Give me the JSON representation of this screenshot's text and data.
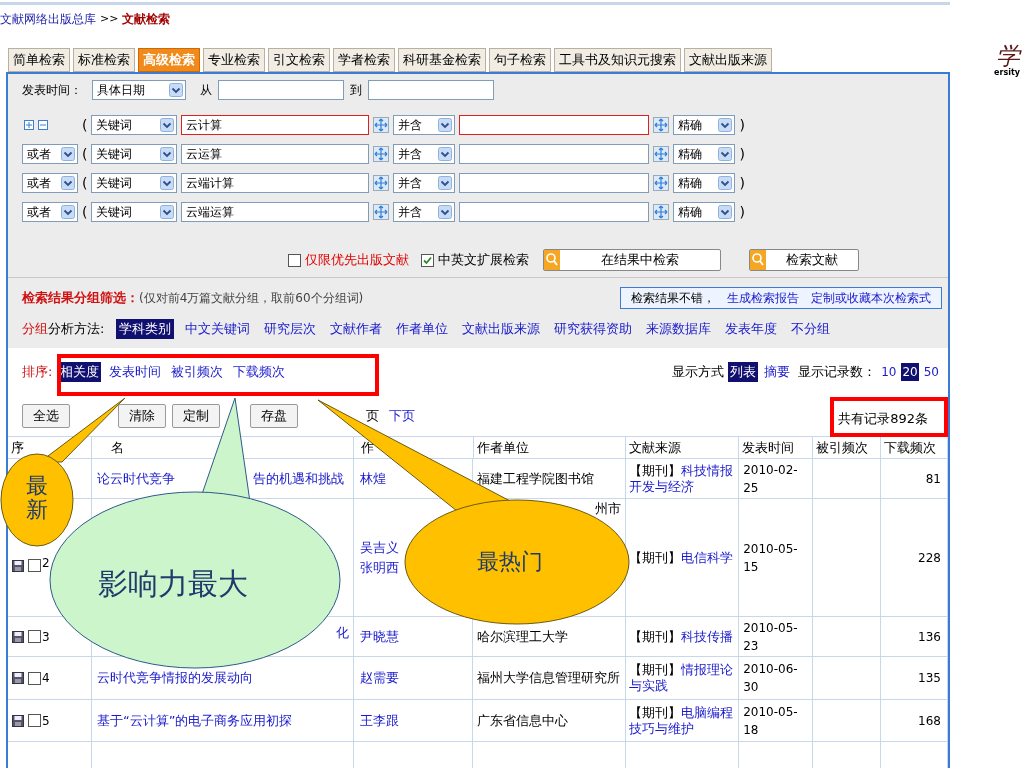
{
  "breadcrumb": {
    "path": "文献网络出版总库",
    "separator": ">>",
    "current": "文献检索"
  },
  "tabs": [
    {
      "label": "简单检索",
      "selected": false
    },
    {
      "label": "标准检索",
      "selected": false
    },
    {
      "label": "高级检索",
      "selected": true
    },
    {
      "label": "专业检索",
      "selected": false
    },
    {
      "label": "引文检索",
      "selected": false
    },
    {
      "label": "学者检索",
      "selected": false
    },
    {
      "label": "科研基金检索",
      "selected": false
    },
    {
      "label": "句子检索",
      "selected": false
    },
    {
      "label": "工具书及知识元搜索",
      "selected": false
    },
    {
      "label": "文献出版来源",
      "selected": false
    }
  ],
  "logo": {
    "glyph": "学",
    "text": "ersity"
  },
  "date_filter": {
    "label": "发表时间：",
    "type": "具体日期",
    "from_label": "从",
    "to_label": "到"
  },
  "conditions": [
    {
      "kind": "first",
      "open": "(",
      "close": ")",
      "field": "关键词",
      "term": "云计算",
      "match": "并含",
      "precision": "精确",
      "highlighted": true
    },
    {
      "kind": "extra",
      "logic": "或者",
      "open": "(",
      "close": ")",
      "field": "关键词",
      "term": "云运算",
      "match": "并含",
      "precision": "精确",
      "highlighted": false
    },
    {
      "kind": "extra",
      "logic": "或者",
      "open": "(",
      "close": ")",
      "field": "关键词",
      "term": "云端计算",
      "match": "并含",
      "precision": "精确",
      "highlighted": false
    },
    {
      "kind": "extra",
      "logic": "或者",
      "open": "(",
      "close": ")",
      "field": "关键词",
      "term": "云端运算",
      "match": "并含",
      "precision": "精确",
      "highlighted": false
    }
  ],
  "options": [
    {
      "label": "仅限优先出版文献",
      "checked": false,
      "highlighted": true
    },
    {
      "label": "中英文扩展检索",
      "checked": true,
      "highlighted": false
    }
  ],
  "search_buttons": [
    "在结果中检索",
    "检索文献"
  ],
  "grouping": {
    "title": "检索结果分组筛选：",
    "note": "(仅对前4万篇文献分组，取前60个分组词)",
    "report": [
      {
        "kind": "text",
        "label": "检索结果不错，"
      },
      {
        "kind": "link",
        "label": "生成检索报告"
      },
      {
        "kind": "link",
        "label": "定制或收藏本次检索式"
      }
    ]
  },
  "methods": {
    "label_red": "分组",
    "label": "分析方法:",
    "items": [
      {
        "label": "学科类别",
        "selected": true
      },
      {
        "label": "中文关键词",
        "selected": false
      },
      {
        "label": "研究层次",
        "selected": false
      },
      {
        "label": "文献作者",
        "selected": false
      },
      {
        "label": "作者单位",
        "selected": false
      },
      {
        "label": "文献出版来源",
        "selected": false
      },
      {
        "label": "研究获得资助",
        "selected": false
      },
      {
        "label": "来源数据库",
        "selected": false
      },
      {
        "label": "发表年度",
        "selected": false
      },
      {
        "label": "不分组",
        "selected": false
      }
    ]
  },
  "sort": {
    "label": "排序:",
    "highlighted": true,
    "items": [
      {
        "label": "相关度",
        "selected": true
      },
      {
        "label": "发表时间",
        "selected": false
      },
      {
        "label": "被引频次",
        "selected": false
      },
      {
        "label": "下载频次",
        "selected": false
      }
    ]
  },
  "display": {
    "label": "显示方式",
    "modes": [
      {
        "label": "列表",
        "selected": true
      },
      {
        "label": "摘要",
        "selected": false
      }
    ],
    "count_label": "显示记录数：",
    "counts": [
      {
        "label": "10",
        "selected": false
      },
      {
        "label": "20",
        "selected": true
      },
      {
        "label": "50",
        "selected": false
      }
    ]
  },
  "actions": [
    "全选",
    "清除",
    "定制",
    "存盘"
  ],
  "pager": [
    "页",
    "下页"
  ],
  "total": {
    "label": "共有记录892条",
    "highlighted": true
  },
  "table": {
    "columns": [
      "序",
      "名",
      "作",
      "作者单位",
      "文献来源",
      "发表时间",
      "被引频次",
      "下载频次"
    ],
    "rows": [
      {
        "title": [
          "论云时代竞争",
          "告的机遇和挑战"
        ],
        "authors": [
          "林煌"
        ],
        "affiliation": [
          "福建工程学院图书馆"
        ],
        "source_type": "【期刊】",
        "source": "科技情报开发与经济",
        "date": "2010-02-25",
        "downloads": "81"
      },
      {
        "number": "2",
        "checked": false,
        "title": [],
        "authors": [
          "吴吉义",
          "张明西"
        ],
        "affiliation": [
          "州市"
        ],
        "source_type": "【期刊】",
        "source": "电信科学",
        "date": "2010-05-15",
        "downloads": "228"
      },
      {
        "number": "3",
        "checked": false,
        "title": [
          "化"
        ],
        "authors": [
          "尹晓慧"
        ],
        "affiliation": [
          "哈尔滨理工大学"
        ],
        "source_type": "【期刊】",
        "source": "科技传播",
        "date": "2010-05-23",
        "downloads": "136"
      },
      {
        "number": "4",
        "checked": false,
        "title": [
          "云时代竞争情报的发展动向"
        ],
        "authors": [
          "赵需要"
        ],
        "affiliation": [
          "福州大学信息管理研究所"
        ],
        "source_type": "【期刊】",
        "source": "情报理论与实践",
        "date": "2010-06-30",
        "downloads": "135"
      },
      {
        "number": "5",
        "checked": false,
        "title": [
          "基于“云计算”的电子商务应用初探"
        ],
        "authors": [
          "王李跟"
        ],
        "affiliation": [
          "广东省信息中心"
        ],
        "source_type": "【期刊】",
        "source": "电脑编程技巧与维护",
        "date": "2010-05-18",
        "downloads": "168"
      }
    ]
  },
  "callouts": [
    {
      "kind": "yellow",
      "label": "最新"
    },
    {
      "kind": "green",
      "label": "影响力最大"
    },
    {
      "kind": "yellow",
      "label": "最热门"
    }
  ]
}
